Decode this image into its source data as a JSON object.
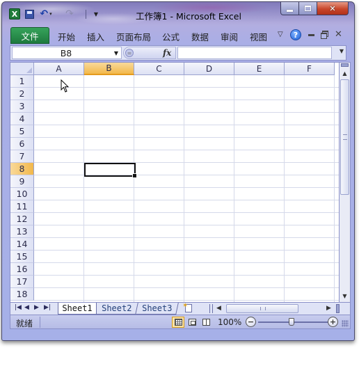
{
  "window": {
    "title": "工作簿1 - Microsoft Excel",
    "excel_icon_letter": "X",
    "controls": {
      "minimize": "minimize",
      "maximize": "maximize",
      "close": "✕"
    }
  },
  "ribbon": {
    "file_tab": "文件",
    "tabs": [
      {
        "label": "开始"
      },
      {
        "label": "插入"
      },
      {
        "label": "页面布局"
      },
      {
        "label": "公式"
      },
      {
        "label": "数据"
      },
      {
        "label": "审阅"
      },
      {
        "label": "视图"
      }
    ],
    "help_glyph": "?"
  },
  "formula_bar": {
    "name_box_value": "B8",
    "fx_label": "fx",
    "formula_value": ""
  },
  "grid": {
    "columns": [
      "A",
      "B",
      "C",
      "D",
      "E",
      "F"
    ],
    "rows": [
      "1",
      "2",
      "3",
      "4",
      "5",
      "6",
      "7",
      "8",
      "9",
      "10",
      "11",
      "12",
      "13",
      "14",
      "15",
      "16",
      "17",
      "18"
    ],
    "active_column": "B",
    "active_row": "8"
  },
  "sheets": {
    "tabs": [
      {
        "label": "Sheet1",
        "active": true
      },
      {
        "label": "Sheet2",
        "active": false
      },
      {
        "label": "Sheet3",
        "active": false
      }
    ]
  },
  "status_bar": {
    "ready_text": "就绪",
    "zoom_level": "100%",
    "zoom_out_glyph": "−",
    "zoom_in_glyph": "+"
  },
  "colors": {
    "file_tab": "#1e7a3e",
    "active_header": "#f2b84b",
    "frame": "#a6b0e8",
    "close_button": "#c8462a"
  }
}
